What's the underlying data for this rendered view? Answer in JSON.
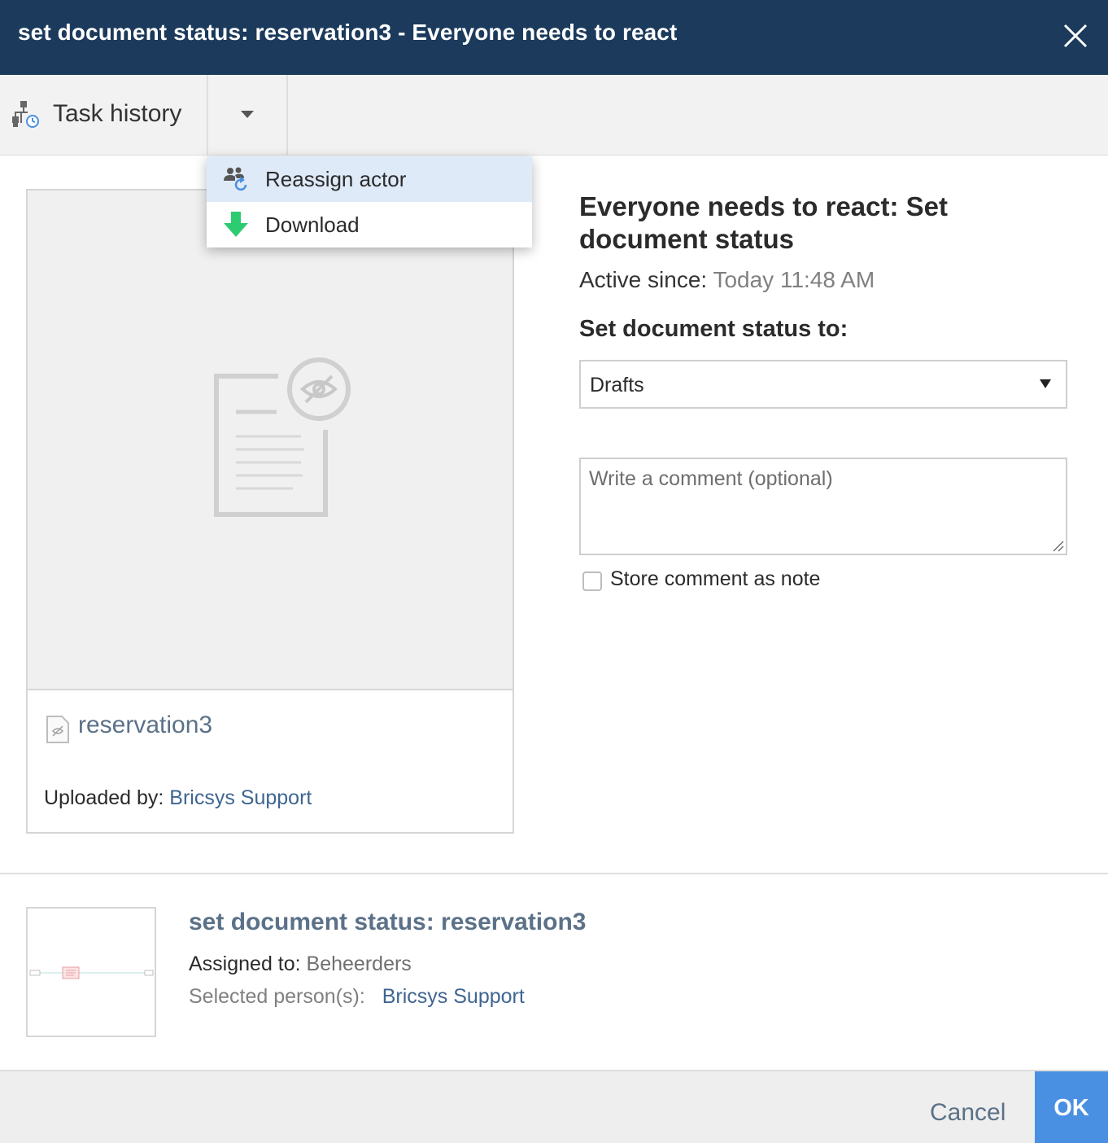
{
  "window": {
    "title": "set document status: reservation3 - Everyone needs to react"
  },
  "toolbar": {
    "task_history_label": "Task history"
  },
  "dropdown_menu": {
    "items": [
      {
        "label": "Reassign actor",
        "icon": "reassign-actor-icon",
        "highlighted": true
      },
      {
        "label": "Download",
        "icon": "download-icon",
        "highlighted": false
      }
    ]
  },
  "document": {
    "file_name": "reservation3",
    "uploaded_by_label": "Uploaded by:",
    "uploaded_by_value": "Bricsys Support",
    "preview_icon": "preview-unavailable-icon"
  },
  "task": {
    "heading": "Everyone needs to react: Set document status",
    "active_since_label": "Active since:",
    "active_since_value": "Today 11:48 AM",
    "status_label": "Set document status to:",
    "status_value": "Drafts",
    "comment_placeholder": "Write a comment (optional)",
    "store_note_label": "Store comment as note",
    "store_note_checked": false
  },
  "workflow": {
    "title": "set document status: reservation3",
    "assigned_label": "Assigned to:",
    "assigned_value": "Beheerders",
    "selected_label": "Selected person(s):",
    "selected_value": "Bricsys Support"
  },
  "footer": {
    "cancel_label": "Cancel",
    "ok_label": "OK"
  },
  "colors": {
    "title_bar": "#1b3a5c",
    "link": "#3f6592",
    "ok_button": "#4a90e2",
    "menu_highlight": "#dfeaf8",
    "download_arrow": "#2ecc71"
  }
}
